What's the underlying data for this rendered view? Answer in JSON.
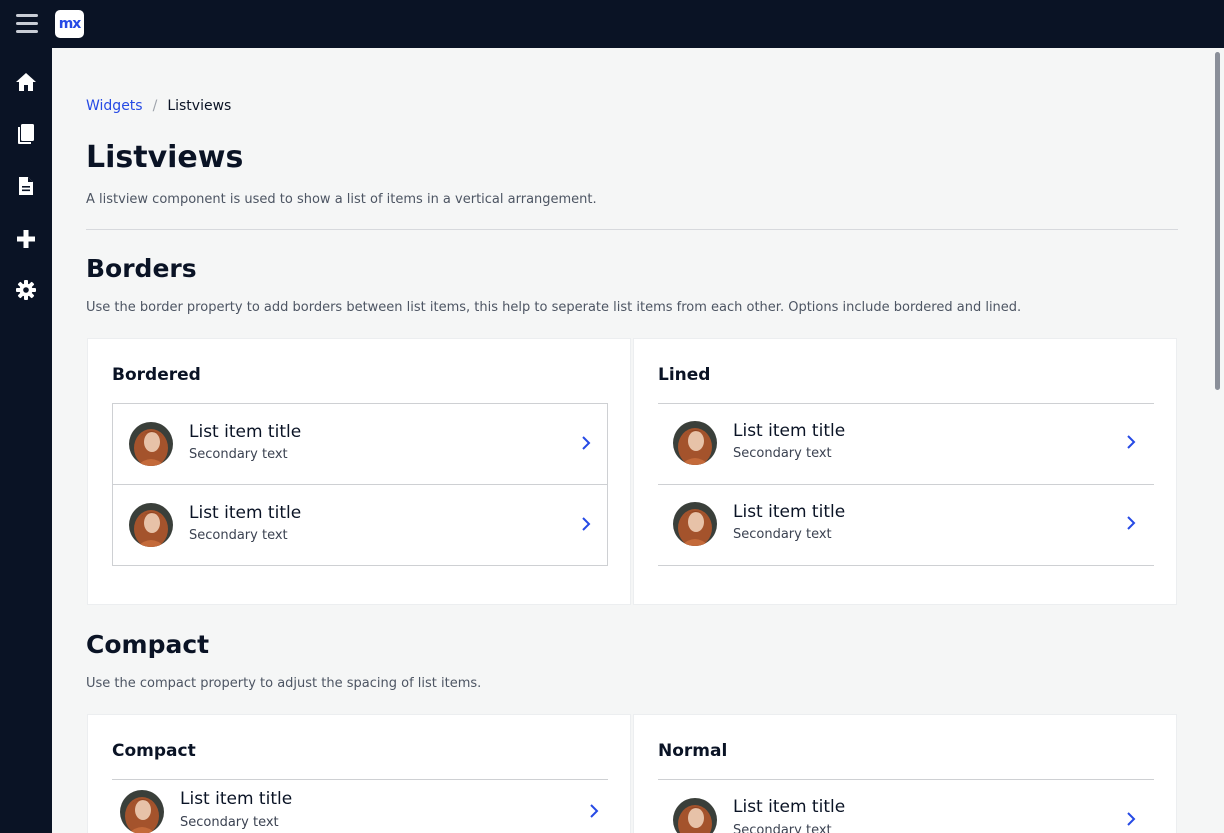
{
  "app": {
    "logo_text": "mx"
  },
  "sidebar": {
    "items": [
      {
        "icon": "home-icon"
      },
      {
        "icon": "book-icon"
      },
      {
        "icon": "file-icon"
      },
      {
        "icon": "plus-icon"
      },
      {
        "icon": "gear-icon"
      }
    ]
  },
  "breadcrumb": {
    "parent": "Widgets",
    "separator": "/",
    "current": "Listviews"
  },
  "page": {
    "title": "Listviews",
    "description": "A listview component is used to show a list of items in a vertical arrangement."
  },
  "borders_section": {
    "title": "Borders",
    "description": "Use the border property to add borders between list items, this help to seperate list items from each other. Options include bordered and lined.",
    "cards": [
      {
        "title": "Bordered",
        "items": [
          {
            "title": "List item title",
            "secondary": "Secondary text"
          },
          {
            "title": "List item title",
            "secondary": "Secondary text"
          }
        ]
      },
      {
        "title": "Lined",
        "items": [
          {
            "title": "List item title",
            "secondary": "Secondary text"
          },
          {
            "title": "List item title",
            "secondary": "Secondary text"
          }
        ]
      }
    ]
  },
  "compact_section": {
    "title": "Compact",
    "description": "Use the compact property to adjust the spacing of list items.",
    "cards": [
      {
        "title": "Compact",
        "items": [
          {
            "title": "List item title",
            "secondary": "Secondary text"
          }
        ]
      },
      {
        "title": "Normal",
        "items": [
          {
            "title": "List item title",
            "secondary": "Secondary text"
          }
        ]
      }
    ]
  },
  "colors": {
    "topbar": "#0a1325",
    "link": "#264ae5",
    "chevron": "#264ae5",
    "background": "#f5f6f6"
  }
}
